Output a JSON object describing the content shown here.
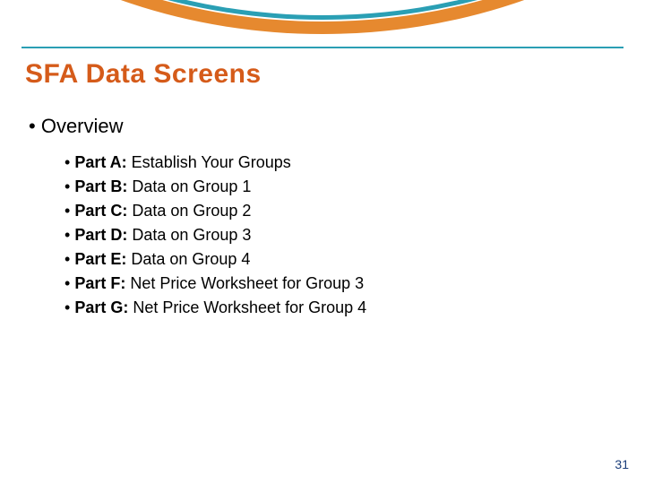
{
  "colors": {
    "teal": "#2a9fb4",
    "orange": "#e6892f",
    "title": "#d55b1a"
  },
  "title": "SFA Data Screens",
  "overview_label": "Overview",
  "parts": [
    {
      "label": "Part A:",
      "text": "Establish Your Groups"
    },
    {
      "label": "Part B:",
      "text": "Data on Group 1"
    },
    {
      "label": "Part C:",
      "text": "Data on Group 2"
    },
    {
      "label": "Part D:",
      "text": "Data on Group 3"
    },
    {
      "label": "Part E:",
      "text": "Data on Group 4"
    },
    {
      "label": "Part F:",
      "text": "Net Price Worksheet for Group 3"
    },
    {
      "label": "Part G:",
      "text": "Net Price Worksheet for Group 4"
    }
  ],
  "page_number": "31"
}
